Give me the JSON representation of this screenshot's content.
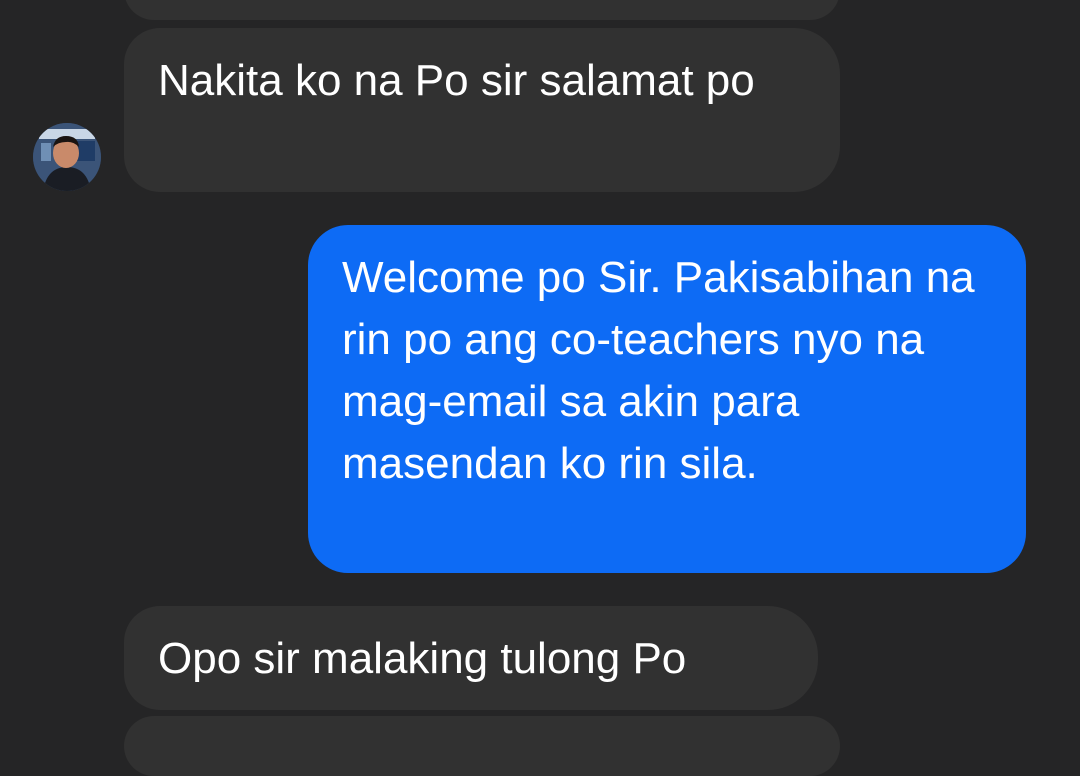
{
  "thread": {
    "messages": [
      {
        "sender": "other",
        "text": "Nakita ko na Po sir salamat po"
      },
      {
        "sender": "me",
        "text": "Welcome po Sir. Pakisabihan na rin po ang co-teachers nyo na mag-email sa akin para masendan ko rin sila."
      },
      {
        "sender": "other",
        "text": "Opo sir malaking tulong Po"
      }
    ]
  },
  "colors": {
    "background": "#252526",
    "received_bubble": "#313131",
    "sent_bubble": "#0d6bf5",
    "text": "#ffffff"
  },
  "avatar": {
    "icon": "person-avatar-icon"
  }
}
